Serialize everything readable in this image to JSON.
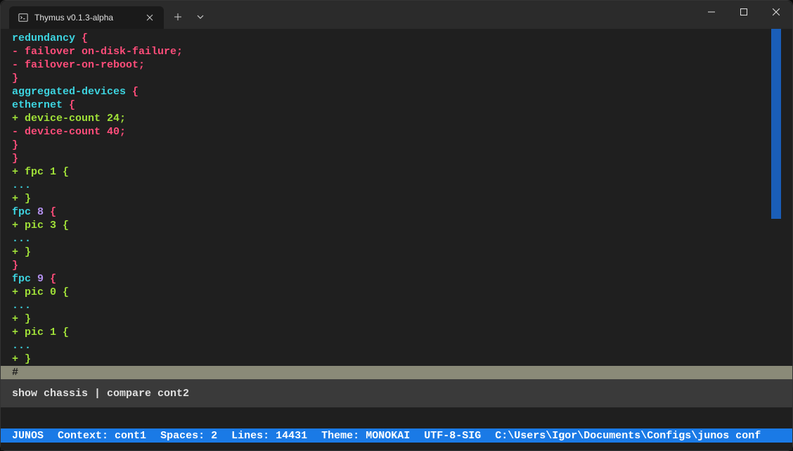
{
  "window": {
    "title": "Thymus v0.1.3-alpha"
  },
  "terminal": {
    "lines": [
      {
        "tokens": [
          {
            "text": "redundancy",
            "class": "c-cyan"
          },
          {
            "text": " ",
            "class": ""
          },
          {
            "text": "{",
            "class": "c-brace"
          }
        ]
      },
      {
        "tokens": [
          {
            "text": "- failover on-disk-failure;",
            "class": "c-red"
          }
        ]
      },
      {
        "tokens": [
          {
            "text": "- failover-on-reboot;",
            "class": "c-red"
          }
        ]
      },
      {
        "tokens": [
          {
            "text": "}",
            "class": "c-brace"
          }
        ]
      },
      {
        "tokens": [
          {
            "text": "aggregated-devices",
            "class": "c-cyan"
          },
          {
            "text": " ",
            "class": ""
          },
          {
            "text": "{",
            "class": "c-brace"
          }
        ]
      },
      {
        "tokens": [
          {
            "text": "ethernet",
            "class": "c-cyan"
          },
          {
            "text": " ",
            "class": ""
          },
          {
            "text": "{",
            "class": "c-brace"
          }
        ]
      },
      {
        "tokens": [
          {
            "text": "+ device-count 24;",
            "class": "c-green"
          }
        ]
      },
      {
        "tokens": [
          {
            "text": "- device-count 40;",
            "class": "c-red"
          }
        ]
      },
      {
        "tokens": [
          {
            "text": "}",
            "class": "c-brace"
          }
        ]
      },
      {
        "tokens": [
          {
            "text": "}",
            "class": "c-brace"
          }
        ]
      },
      {
        "tokens": [
          {
            "text": "+ fpc 1 {",
            "class": "c-green"
          }
        ]
      },
      {
        "tokens": [
          {
            "text": "...",
            "class": "c-dots"
          }
        ]
      },
      {
        "tokens": [
          {
            "text": "+ }",
            "class": "c-green"
          }
        ]
      },
      {
        "tokens": [
          {
            "text": "fpc",
            "class": "c-cyan"
          },
          {
            "text": " ",
            "class": ""
          },
          {
            "text": "8",
            "class": "c-num"
          },
          {
            "text": " ",
            "class": ""
          },
          {
            "text": "{",
            "class": "c-brace"
          }
        ]
      },
      {
        "tokens": [
          {
            "text": "+ pic 3 {",
            "class": "c-green"
          }
        ]
      },
      {
        "tokens": [
          {
            "text": "...",
            "class": "c-dots"
          }
        ]
      },
      {
        "tokens": [
          {
            "text": "+ }",
            "class": "c-green"
          }
        ]
      },
      {
        "tokens": [
          {
            "text": "}",
            "class": "c-brace"
          }
        ]
      },
      {
        "tokens": [
          {
            "text": "fpc",
            "class": "c-cyan"
          },
          {
            "text": " ",
            "class": ""
          },
          {
            "text": "9",
            "class": "c-num"
          },
          {
            "text": " ",
            "class": ""
          },
          {
            "text": "{",
            "class": "c-brace"
          }
        ]
      },
      {
        "tokens": [
          {
            "text": "+ pic 0 {",
            "class": "c-green"
          }
        ]
      },
      {
        "tokens": [
          {
            "text": "...",
            "class": "c-dots"
          }
        ]
      },
      {
        "tokens": [
          {
            "text": "+ }",
            "class": "c-green"
          }
        ]
      },
      {
        "tokens": [
          {
            "text": "+ pic 1 {",
            "class": "c-green"
          }
        ]
      },
      {
        "tokens": [
          {
            "text": "...",
            "class": "c-dots"
          }
        ]
      },
      {
        "tokens": [
          {
            "text": "+ }",
            "class": "c-green"
          }
        ]
      }
    ],
    "cursor_char": "#",
    "command": "show chassis | compare cont2"
  },
  "status": {
    "mode": "JUNOS",
    "context_label": "Context:",
    "context_value": "cont1",
    "spaces_label": "Spaces:",
    "spaces_value": "2",
    "lines_label": "Lines:",
    "lines_value": "14431",
    "theme_label": "Theme:",
    "theme_value": "MONOKAI",
    "encoding": "UTF-8-SIG",
    "path": "C:\\Users\\Igor\\Documents\\Configs\\junos conf"
  }
}
